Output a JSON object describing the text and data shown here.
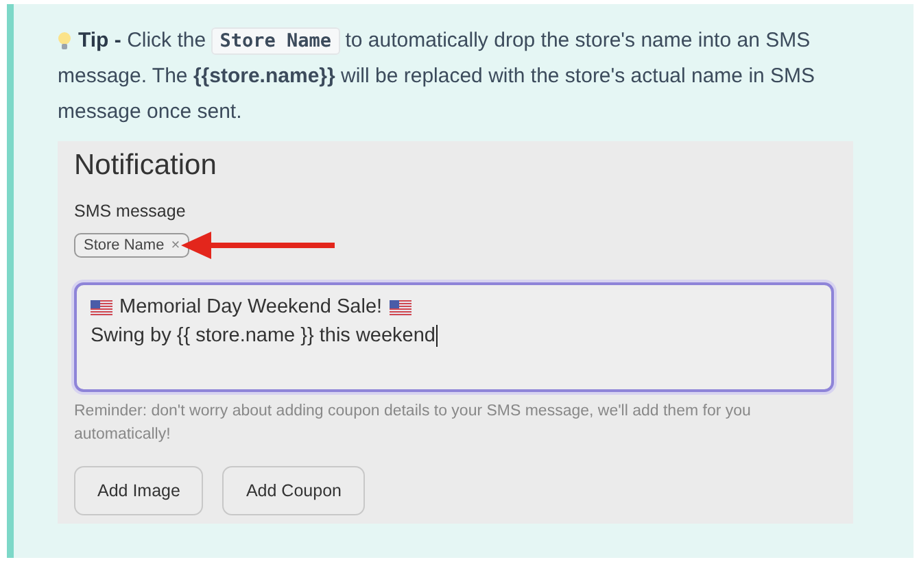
{
  "tip": {
    "label": "Tip -",
    "before": "Click the",
    "code": "Store Name",
    "after": "to automatically drop the store's name into an SMS message. The **{{store.name}}** will be replaced with the store's actual name in SMS message once sent."
  },
  "notification": {
    "title": "Notification",
    "field_label": "SMS message",
    "chip": {
      "label": "Store Name",
      "remove": "×"
    },
    "message": {
      "lines": [
        {
          "text": "Memorial Day Weekend Sale!",
          "flags": true
        },
        {
          "text": "Swing by {{ store.name }} this weekend",
          "flags": false
        }
      ],
      "focused": true
    },
    "reminder": "Reminder: don't worry about adding coupon details to your SMS message, we'll add them for you automatically!",
    "buttons": [
      "Add Image",
      "Add Coupon"
    ]
  }
}
